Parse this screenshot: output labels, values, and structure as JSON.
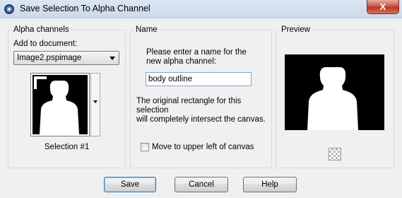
{
  "window": {
    "title": "Save Selection To Alpha Channel",
    "close_label": "X"
  },
  "alpha_group": {
    "title": "Alpha channels",
    "add_to_label": "Add to document:",
    "document_selected": "Image2.pspimage",
    "selection_caption": "Selection #1"
  },
  "name_group": {
    "title": "Name",
    "prompt_line1": "Please enter a name for the",
    "prompt_line2": "new alpha channel:",
    "name_value": "body outline",
    "info_line1": "The original rectangle for this selection",
    "info_line2": "will completely intersect the canvas.",
    "checkbox_label": "Move to upper left of canvas",
    "checkbox_checked": false
  },
  "preview_group": {
    "title": "Preview"
  },
  "buttons": {
    "save": "Save",
    "cancel": "Cancel",
    "help": "Help"
  },
  "colors": {
    "mask_foreground": "#ffffff",
    "mask_background": "#000000",
    "default_button_border": "#3c7fb1"
  }
}
